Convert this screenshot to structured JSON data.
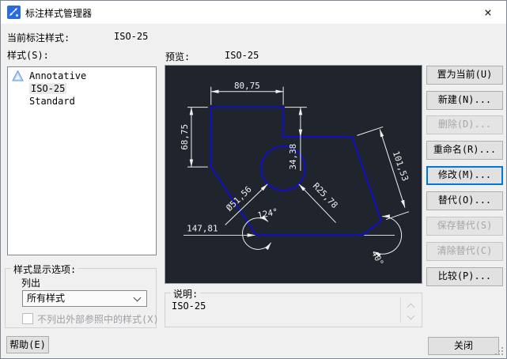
{
  "window": {
    "title": "标注样式管理器",
    "close_glyph": "×"
  },
  "current": {
    "label": "当前标注样式:",
    "value": "ISO-25"
  },
  "styles_list": {
    "label": "样式(S):",
    "selected": "ISO-25",
    "items": [
      {
        "name": "Annotative",
        "annotative": true
      },
      {
        "name": "ISO-25",
        "selected": true
      },
      {
        "name": "Standard"
      }
    ]
  },
  "preview": {
    "label": "预览:",
    "value": "ISO-25",
    "dims": {
      "top_h": "80,75",
      "left_v": "68,75",
      "mid_v": "34,38",
      "aligned": "101,53",
      "radius": "R25,78",
      "diameter": "Ø51,56",
      "angle_left": "124°",
      "bottom_h": "147,81",
      "angle_right": "40°"
    }
  },
  "actions": [
    {
      "label": "置为当前(U)",
      "state": "enabled"
    },
    {
      "label": "新建(N)...",
      "state": "enabled"
    },
    {
      "label": "删除(D)...",
      "state": "disabled"
    },
    {
      "label": "重命名(R)...",
      "state": "enabled"
    },
    {
      "label": "修改(M)...",
      "state": "focused"
    },
    {
      "label": "替代(O)...",
      "state": "enabled"
    },
    {
      "label": "保存替代(S)",
      "state": "disabled"
    },
    {
      "label": "清除替代(C)",
      "state": "disabled"
    },
    {
      "label": "比较(P)...",
      "state": "enabled"
    }
  ],
  "display_options": {
    "group_label": "样式显示选项:",
    "list_label": "列出",
    "combo_value": "所有样式",
    "xref_checkbox_label": "不列出外部参照中的样式(X)",
    "xref_checked": false
  },
  "description": {
    "label": "说明:",
    "value": "ISO-25"
  },
  "footer": {
    "help_label": "帮助(E)",
    "close_label": "关闭"
  },
  "colors": {
    "accent": "#0078d7",
    "canvas_bg": "#20242c",
    "geometry_blue": "#0a0aee",
    "dimension_white": "#f0f0f0"
  }
}
